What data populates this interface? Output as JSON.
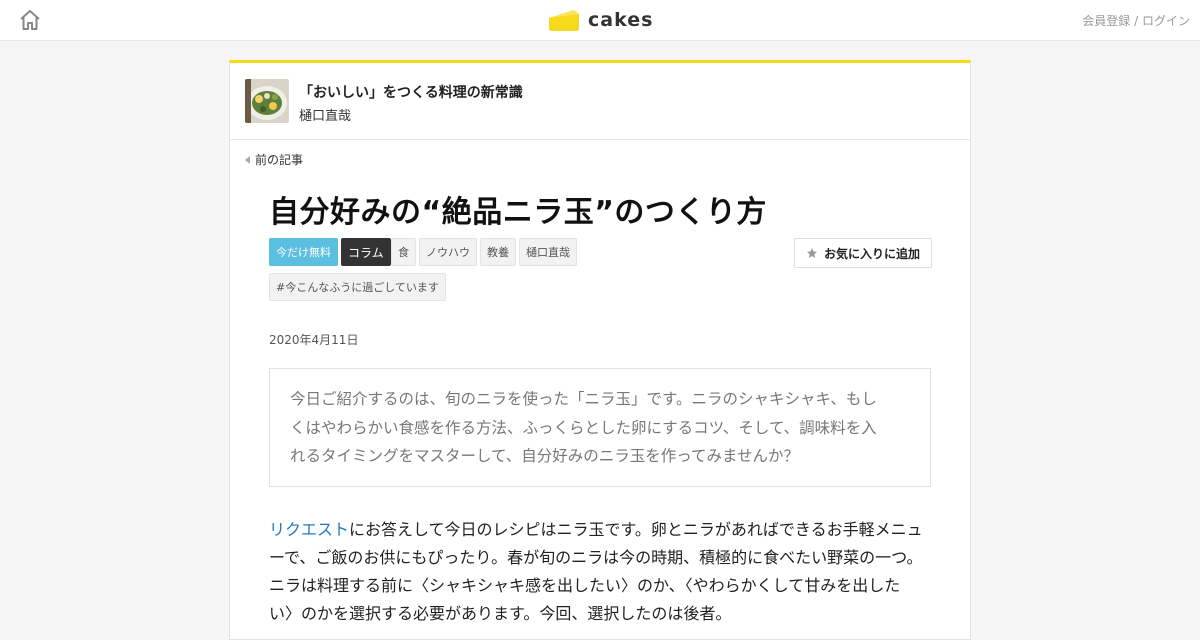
{
  "header": {
    "logo_text": "cakes",
    "signup_label": "会員登録",
    "separator": " / ",
    "login_label": "ログイン",
    "brand_color": "#f6d91b"
  },
  "series": {
    "title": "「おいしい」をつくる料理の新常識",
    "author": "樋口直哉"
  },
  "nav": {
    "prev_label": "前の記事"
  },
  "article": {
    "title": "自分好みの“絶品ニラ玉”のつくり方",
    "tags": [
      "今だけ無料",
      "コラム",
      "食",
      "ノウハウ",
      "教養",
      "樋口直哉"
    ],
    "hashtag": "#今こんなふうに過ごしています",
    "favorite_label": "お気に入りに追加",
    "date": "2020年4月11日",
    "lead_lines": [
      "今日ご紹介するのは、旬のニラを使った「ニラ玉」です。ニラのシャキシャキ、もし",
      "くはやわらかい食感を作る方法、ふっくらとした卵にするコツ、そして、調味料を入",
      "れるタイミングをマスターして、自分好みのニラ玉を作ってみませんか？"
    ],
    "body_link": "リクエスト",
    "body_lines": [
      "にお答えして今日のレシピはニラ玉です。卵とニラがあればできるお手軽メニュ",
      "ーで、ご飯のお供にもぴったり。春が旬のニラは今の時期、積極的に食べたい野菜の一つ。",
      "ニラは料理する前に〈シャキシャキ感を出したい〉のか、〈やわらかくして甘みを出した",
      "い〉のかを選択する必要があります。今回、選択したのは後者。"
    ]
  }
}
